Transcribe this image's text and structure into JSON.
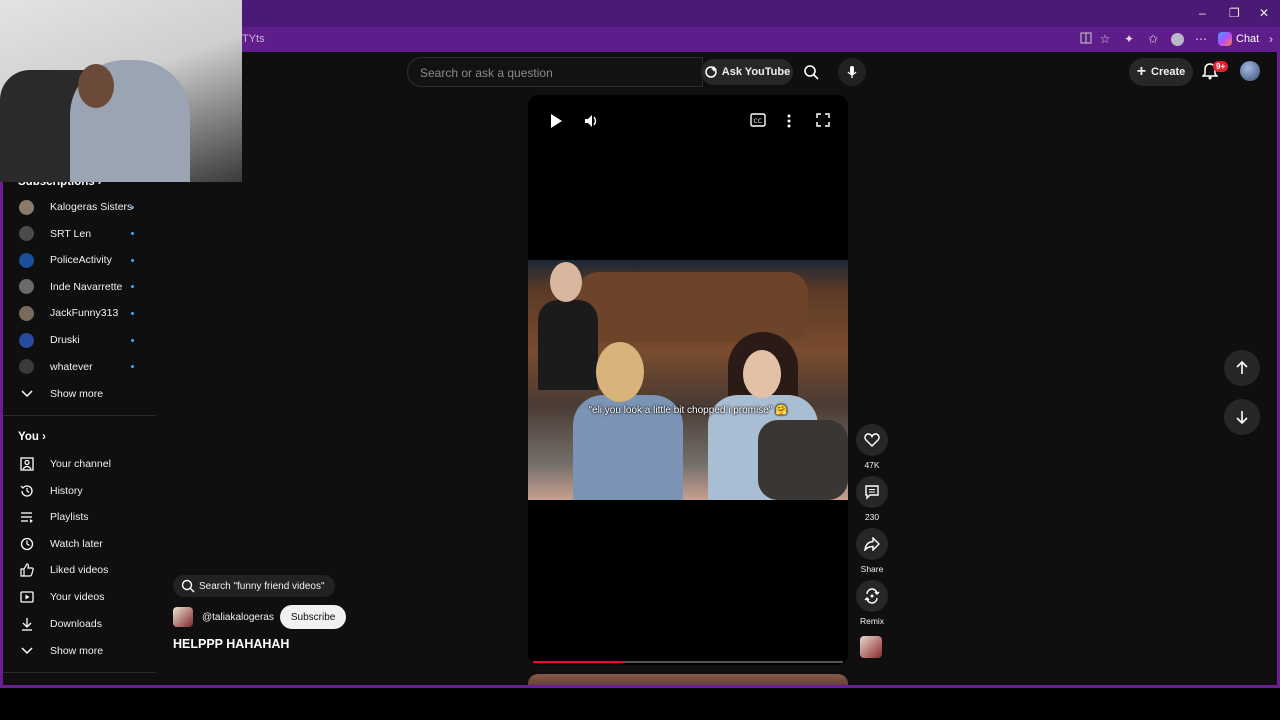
{
  "browser": {
    "tab_text": "TYts",
    "chat_label": "Chat",
    "window_controls": [
      "–",
      "❐",
      "✕"
    ]
  },
  "header": {
    "search_placeholder": "Search or ask a question",
    "ask_label": "Ask YouTube",
    "create_label": "Create",
    "notification_count": "9+"
  },
  "sidebar": {
    "subscriptions_heading": "Subscriptions",
    "subscriptions": [
      {
        "name": "Kalogeras Sisters",
        "color": "#8a7a6a"
      },
      {
        "name": "SRT Len",
        "color": "#4a4a4a"
      },
      {
        "name": "PoliceActivity",
        "color": "#1a4f9a"
      },
      {
        "name": "Inde Navarrette",
        "color": "#6a6a6a"
      },
      {
        "name": "JackFunny313",
        "color": "#7a6a5a"
      },
      {
        "name": "Druski",
        "color": "#2a4aa0"
      },
      {
        "name": "whatever",
        "color": "#3a3a3a"
      }
    ],
    "subs_show_more": "Show more",
    "you_heading": "You",
    "you_items": [
      {
        "label": "Your channel",
        "icon": "channel-icon"
      },
      {
        "label": "History",
        "icon": "history-icon"
      },
      {
        "label": "Playlists",
        "icon": "playlists-icon"
      },
      {
        "label": "Watch later",
        "icon": "clock-icon"
      },
      {
        "label": "Liked videos",
        "icon": "thumbs-up-icon"
      },
      {
        "label": "Your videos",
        "icon": "video-icon"
      },
      {
        "label": "Downloads",
        "icon": "download-icon"
      }
    ],
    "you_show_more": "Show more"
  },
  "video": {
    "caption": "\"eli you look a little bit chopped i promise\" 🤗",
    "progress": 0.29
  },
  "actions": {
    "likes": "47K",
    "comments": "230",
    "share": "Share",
    "remix": "Remix"
  },
  "info": {
    "search_suggestion": "Search \"funny friend videos\"",
    "channel_handle": "@taliakalogeras",
    "subscribe_label": "Subscribe",
    "title": "HELPPP HAHAHAH"
  },
  "colors": {
    "accent": "#ff0033",
    "frame": "#6a1d97",
    "background": "#0f0f0f"
  }
}
